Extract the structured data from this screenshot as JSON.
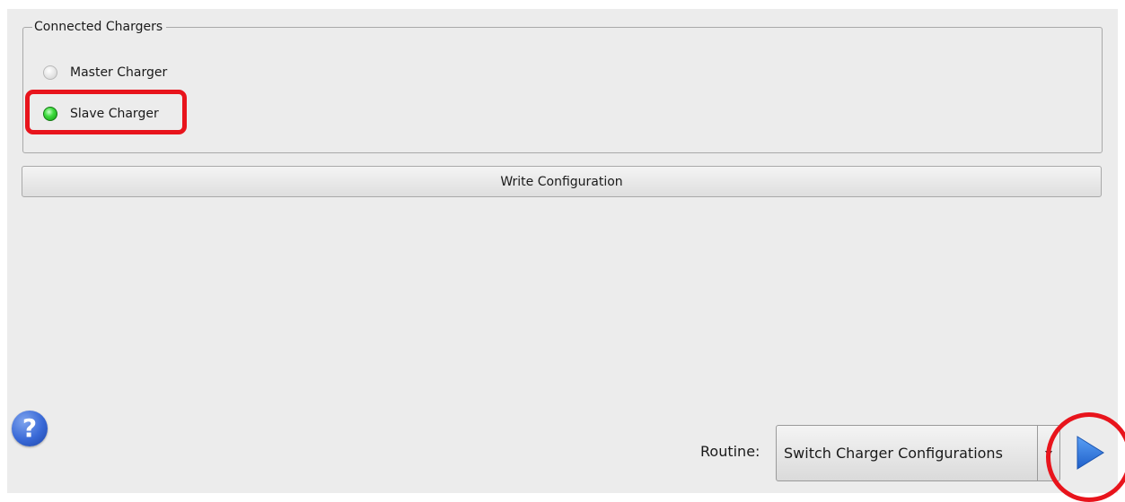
{
  "chargers_group": {
    "title": "Connected Chargers",
    "items": [
      {
        "label": "Master Charger",
        "status": "off"
      },
      {
        "label": "Slave Charger",
        "status": "on"
      }
    ]
  },
  "actions": {
    "write_label": "Write Configuration"
  },
  "footer": {
    "help_glyph": "?",
    "routine_label": "Routine:",
    "routine_value": "Switch Charger Configurations"
  },
  "colors": {
    "highlight": "#e8141c",
    "led_on": "#3fdc3f",
    "play": "#2f78e6",
    "help": "#3868d6"
  },
  "icons": [
    "led-off-icon",
    "led-on-icon",
    "help-icon",
    "dropdown-arrow-icon",
    "play-icon"
  ]
}
